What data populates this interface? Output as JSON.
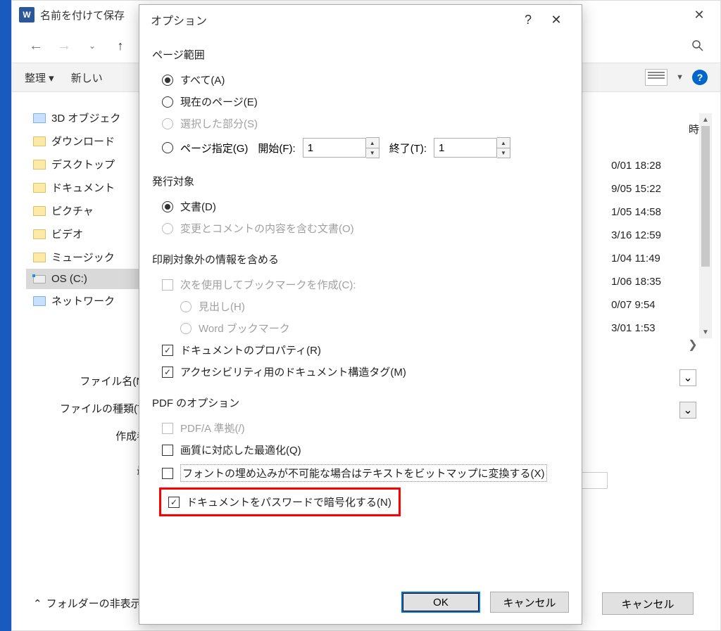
{
  "saveas": {
    "title": "名前を付けて保存",
    "toolbar": {
      "organize": "整理 ▾",
      "newfolder": "新しい"
    },
    "header_date": "時",
    "tree": [
      {
        "name": "3D オブジェク",
        "type": "blue"
      },
      {
        "name": "ダウンロード",
        "type": "folder"
      },
      {
        "name": "デスクトップ",
        "type": "folder"
      },
      {
        "name": "ドキュメント",
        "type": "folder"
      },
      {
        "name": "ピクチャ",
        "type": "folder"
      },
      {
        "name": "ビデオ",
        "type": "folder"
      },
      {
        "name": "ミュージック",
        "type": "folder"
      },
      {
        "name": "OS (C:)",
        "type": "drive",
        "selected": true
      },
      {
        "name": "ネットワーク",
        "type": "blue"
      }
    ],
    "dates": [
      "0/01 18:28",
      "9/05 15:22",
      "1/05 14:58",
      "3/16 12:59",
      "1/04 11:49",
      "1/06 18:35",
      "0/07 9:54",
      "3/01 1:53"
    ],
    "form": {
      "filename_label": "ファイル名(N)",
      "filetype_label": "ファイルの種類(T)",
      "author_label": "作成者",
      "last_label": "最"
    },
    "folder_toggle": "フォルダーの非表示",
    "cancel": "キャンセル"
  },
  "options": {
    "title": "オプション",
    "sections": {
      "page_range": "ページ範囲",
      "publish": "発行対象",
      "include": "印刷対象外の情報を含める",
      "pdf": "PDF のオプション"
    },
    "page_range": {
      "all": "すべて(A)",
      "current": "現在のページ(E)",
      "selection": "選択した部分(S)",
      "pages": "ページ指定(G)",
      "from_label": "開始(F):",
      "to_label": "終了(T):",
      "from_value": "1",
      "to_value": "1"
    },
    "publish": {
      "document": "文書(D)",
      "with_markup": "変更とコメントの内容を含む文書(O)"
    },
    "include": {
      "bookmarks": "次を使用してブックマークを作成(C):",
      "headings": "見出し(H)",
      "word_bookmarks": "Word ブックマーク",
      "properties": "ドキュメントのプロパティ(R)",
      "a11y": "アクセシビリティ用のドキュメント構造タグ(M)"
    },
    "pdf": {
      "pdfa": "PDF/A 準拠(/)",
      "quality": "画質に対応した最適化(Q)",
      "bitmap": "フォントの埋め込みが不可能な場合はテキストをビットマップに変換する(X)",
      "encrypt": "ドキュメントをパスワードで暗号化する(N)"
    },
    "buttons": {
      "ok": "OK",
      "cancel": "キャンセル"
    }
  }
}
